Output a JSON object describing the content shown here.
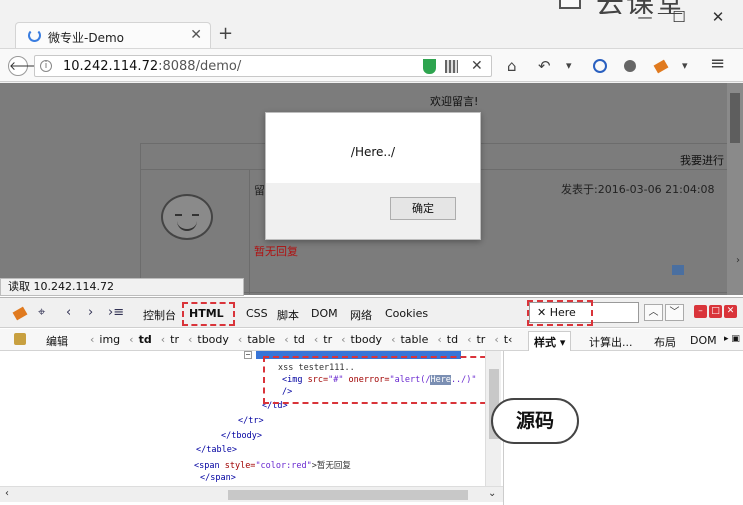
{
  "watermark": {
    "text": "云课堂"
  },
  "window": {
    "minimize": "—",
    "maximize": "☐",
    "close": "✕"
  },
  "tab": {
    "title": "微专业-Demo",
    "close": "✕",
    "new_tab": "+"
  },
  "address": {
    "host": "10.242.114.72",
    "rest": ":8088/demo/",
    "info": "i",
    "clear": "✕"
  },
  "nav_icons": {
    "back": "🡐",
    "home": "⌂",
    "undo": "↶",
    "dropdown": "▾",
    "menu": "≡"
  },
  "page": {
    "welcome": "欢迎留言!",
    "right_label": "我要进行",
    "post_date": "发表于:2016-03-06 21:04:08",
    "reply_status": "暂无回复",
    "partial_label": "留"
  },
  "dialog": {
    "message": "/Here../",
    "ok_label": "确定"
  },
  "status_bar": {
    "text": "读取 10.242.114.72"
  },
  "devtools": {
    "toolbar": {
      "console": "控制台",
      "html": "HTML ▾",
      "css": "CSS",
      "script": "脚本",
      "dom": "DOM",
      "net": "网络",
      "cookies": "Cookies",
      "search_value": "✕ Here"
    },
    "edit_label": "编辑",
    "breadcrumbs": [
      "img",
      "td",
      "tr",
      "tbody",
      "table",
      "td",
      "tr",
      "tbody",
      "table",
      "td",
      "tr",
      "t‹"
    ],
    "side_tabs": {
      "styles": "样式 ▾",
      "computed": "计算出...",
      "layout": "布局",
      "dom": "DOM"
    },
    "code_lines": {
      "l1": "xss tester111..",
      "l2_tag_open": "<img ",
      "l2_attr1": "src=",
      "l2_val1": "\"#\"",
      "l2_attr2": " onerror=",
      "l2_val2a": "\"alert(/",
      "l2_hl": "Here",
      "l2_val2b": "../)\"",
      "l3": "/>",
      "l4": "</td>",
      "l5": "</tr>",
      "l6": "</tbody>",
      "l7": "</table>",
      "l8_open": "<span ",
      "l8_attr": "style=",
      "l8_val": "\"color:red\"",
      "l8_text": ">暂无回复",
      "l9": "</span>"
    },
    "callout": "源码"
  },
  "colors": {
    "highlight": "#d9343a",
    "selection": "#3875d7",
    "reply_red": "#b01010"
  }
}
